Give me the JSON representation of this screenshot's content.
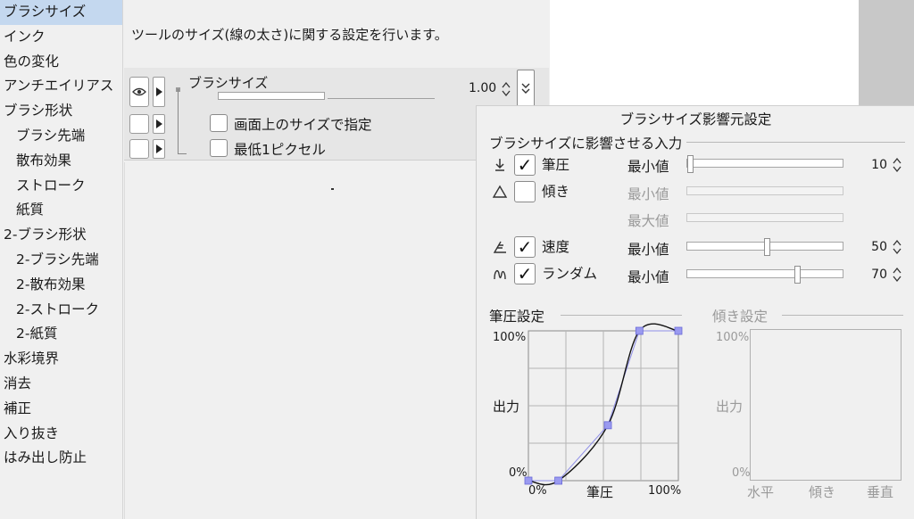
{
  "nav": {
    "items": [
      {
        "label": "ブラシサイズ",
        "level": 0,
        "selected": true
      },
      {
        "label": "インク",
        "level": 0
      },
      {
        "label": "色の変化",
        "level": 0
      },
      {
        "label": "アンチエイリアス",
        "level": 0
      },
      {
        "label": "ブラシ形状",
        "level": 0
      },
      {
        "label": "ブラシ先端",
        "level": 1
      },
      {
        "label": "散布効果",
        "level": 1
      },
      {
        "label": "ストローク",
        "level": 1
      },
      {
        "label": "紙質",
        "level": 1
      },
      {
        "label": "2-ブラシ形状",
        "level": 0
      },
      {
        "label": "2-ブラシ先端",
        "level": 1
      },
      {
        "label": "2-散布効果",
        "level": 1
      },
      {
        "label": "2-ストローク",
        "level": 1
      },
      {
        "label": "2-紙質",
        "level": 1
      },
      {
        "label": "水彩境界",
        "level": 0
      },
      {
        "label": "消去",
        "level": 0
      },
      {
        "label": "補正",
        "level": 0
      },
      {
        "label": "入り抜き",
        "level": 0
      },
      {
        "label": "はみ出し防止",
        "level": 0
      }
    ]
  },
  "main": {
    "description": "ツールのサイズ(線の太さ)に関する設定を行います。",
    "brush_size": {
      "label": "ブラシサイズ",
      "value": "1.00"
    },
    "options": [
      {
        "label": "画面上のサイズで指定",
        "checked": false
      },
      {
        "label": "最低1ピクセル",
        "checked": false
      }
    ]
  },
  "popup": {
    "title": "ブラシサイズ影響元設定",
    "section": "ブラシサイズに影響させる入力",
    "inputs": [
      {
        "icon": "pen-pressure-icon",
        "label": "筆圧",
        "checked": true,
        "sliders": [
          {
            "label": "最小値",
            "value": "10",
            "level": 10,
            "enabled": true
          }
        ]
      },
      {
        "icon": "tilt-icon",
        "label": "傾き",
        "checked": false,
        "sliders": [
          {
            "label": "最小値",
            "enabled": false
          },
          {
            "label": "最大値",
            "enabled": false
          }
        ]
      },
      {
        "icon": "speed-icon",
        "label": "速度",
        "checked": true,
        "sliders": [
          {
            "label": "最小値",
            "value": "50",
            "level": 50,
            "enabled": true
          }
        ]
      },
      {
        "icon": "random-icon",
        "label": "ランダム",
        "checked": true,
        "sliders": [
          {
            "label": "最小値",
            "value": "70",
            "level": 70,
            "enabled": true
          }
        ]
      }
    ],
    "pressure_graph": {
      "title": "筆圧設定",
      "y_label": "出力",
      "y_max": "100%",
      "y_min": "0%",
      "x_label": "筆圧",
      "x_min": "0%",
      "x_max": "100%",
      "control_points": [
        [
          0,
          0
        ],
        [
          20,
          0
        ],
        [
          53,
          37
        ],
        [
          74,
          100
        ],
        [
          100,
          100
        ]
      ]
    },
    "tilt_graph": {
      "title": "傾き設定",
      "y_label": "出力",
      "y_max": "100%",
      "y_min": "0%",
      "x_labels": [
        "水平",
        "傾き",
        "垂直"
      ]
    }
  },
  "colors": {
    "selected": "#c4d8ef",
    "control_point": "#9a9af0",
    "curve": "#111111"
  }
}
